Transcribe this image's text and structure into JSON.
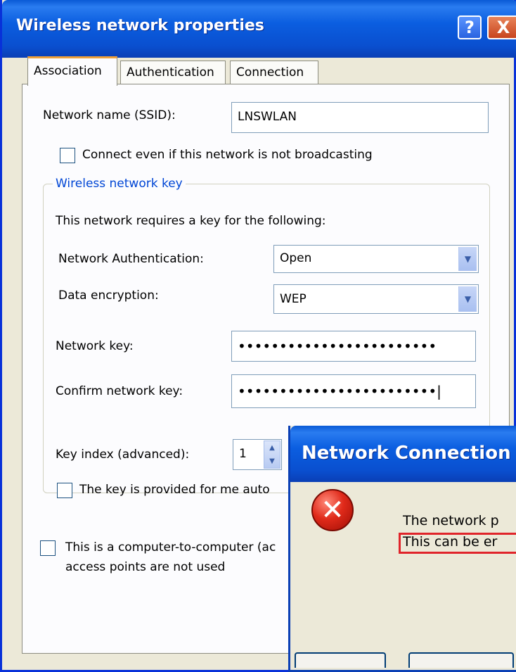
{
  "window": {
    "title": "Wireless network properties",
    "help_glyph": "?",
    "close_glyph": "X"
  },
  "tabs": [
    "Association",
    "Authentication",
    "Connection"
  ],
  "association": {
    "ssid_label": "Network name (SSID):",
    "ssid_value": "LNSWLAN",
    "broadcast_label": "Connect even if this network is not broadcasting",
    "group_title": "Wireless network key",
    "requires_text": "This network requires a key for the following:",
    "auth_label": "Network Authentication:",
    "auth_value": "Open",
    "encryption_label": "Data encryption:",
    "encryption_value": "WEP",
    "key_label": "Network key:",
    "key_value": "••••••••••••••••••••••••",
    "confirm_label": "Confirm network key:",
    "confirm_value": "••••••••••••••••••••••••|",
    "key_index_label": "Key index (advanced):",
    "key_index_value": "1",
    "auto_key_label": "The key is provided for me auto",
    "adhoc_label_line1": "This is a computer-to-computer (ac",
    "adhoc_label_line2": "access points are not used"
  },
  "error_dialog": {
    "title": "Network Connection",
    "icon": "error-x-icon",
    "message_line1": "The network p",
    "message_line2": "This can be er"
  },
  "colors": {
    "title_blue": "#0a4fcf",
    "group_title": "#0046d5",
    "highlight": "#e0242a",
    "error_red": "#e02a1a"
  }
}
